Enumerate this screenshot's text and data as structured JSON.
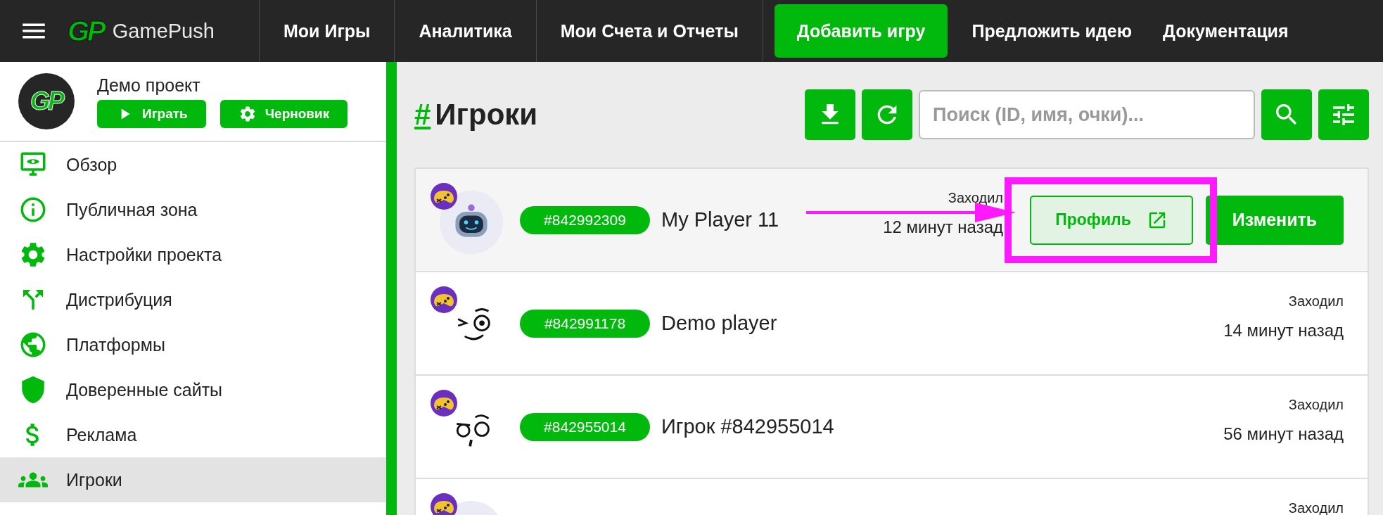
{
  "topbar": {
    "logo": {
      "mark": "GP",
      "name": "GamePush"
    },
    "nav": [
      {
        "label": "Мои Игры",
        "kind": "tab"
      },
      {
        "label": "Аналитика",
        "kind": "tab"
      },
      {
        "label": "Мои Счета и Отчеты",
        "kind": "tab"
      },
      {
        "label": "Добавить игру",
        "kind": "primary"
      },
      {
        "label": "Предложить идею",
        "kind": "link"
      },
      {
        "label": "Документация",
        "kind": "link"
      }
    ]
  },
  "sidebar": {
    "project": {
      "avatar_mark": "GP",
      "name": "Демо проект",
      "buttons": [
        "Играть",
        "Черновик"
      ]
    },
    "items": [
      {
        "label": "Обзор",
        "selected": false
      },
      {
        "label": "Публичная зона",
        "selected": false
      },
      {
        "label": "Настройки проекта",
        "selected": false
      },
      {
        "label": "Дистрибуция",
        "selected": false
      },
      {
        "label": "Платформы",
        "selected": false
      },
      {
        "label": "Доверенные сайты",
        "selected": false
      },
      {
        "label": "Реклама",
        "selected": false
      },
      {
        "label": "Игроки",
        "selected": true
      }
    ]
  },
  "main": {
    "hash": "#",
    "title": "Игроки",
    "search": {
      "placeholder": "Поиск (ID, имя, очки)..."
    },
    "players": [
      {
        "id": "#842992309",
        "name": "My Player 11",
        "visit_label": "Заходил",
        "visit_time": "12 минут назад",
        "actions": [
          "Профиль",
          "Изменить"
        ]
      },
      {
        "id": "#842991178",
        "name": "Demo player",
        "visit_label": "Заходил",
        "visit_time": "14 минут назад"
      },
      {
        "id": "#842955014",
        "name": "Игрок #842955014",
        "visit_label": "Заходил",
        "visit_time": "56 минут назад"
      },
      {
        "visit_label": "Заходил"
      }
    ]
  }
}
